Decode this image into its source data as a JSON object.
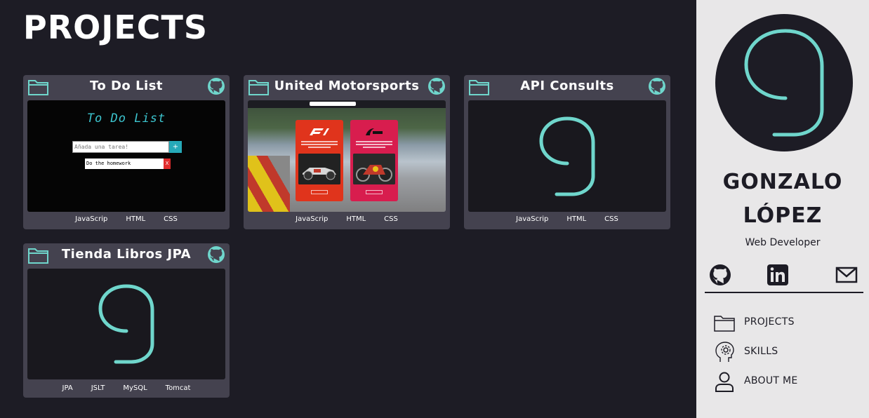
{
  "page": {
    "title": "PROJECTS"
  },
  "projects": [
    {
      "title": "To Do List",
      "tags": [
        "JavaScrip",
        "HTML",
        "CSS"
      ],
      "preview": {
        "heading": "To Do List",
        "input_placeholder": "Añada una tarea!",
        "add_label": "+",
        "item_text": "Do the homework",
        "delete_label": "X"
      }
    },
    {
      "title": "United Motorsports",
      "tags": [
        "JavaScrip",
        "HTML",
        "CSS"
      ]
    },
    {
      "title": "API Consults",
      "tags": [
        "JavaScrip",
        "HTML",
        "CSS"
      ]
    },
    {
      "title": "Tienda Libros JPA",
      "tags": [
        "JPA",
        "JSLT",
        "MySQL",
        "Tomcat"
      ]
    }
  ],
  "sidebar": {
    "first_name": "GONZALO",
    "last_name": "LÓPEZ",
    "role": "Web Developer",
    "social": [
      "github-icon",
      "linkedin-icon",
      "mail-icon"
    ],
    "nav": [
      {
        "label": "PROJECTS",
        "icon": "folder-icon"
      },
      {
        "label": "SKILLS",
        "icon": "head-gear-icon"
      },
      {
        "label": "ABOUT ME",
        "icon": "user-icon"
      }
    ]
  },
  "colors": {
    "background": "#1d1c25",
    "card": "#44424f",
    "accent": "#6fd6cc",
    "sidebar": "#e8e7e8"
  }
}
